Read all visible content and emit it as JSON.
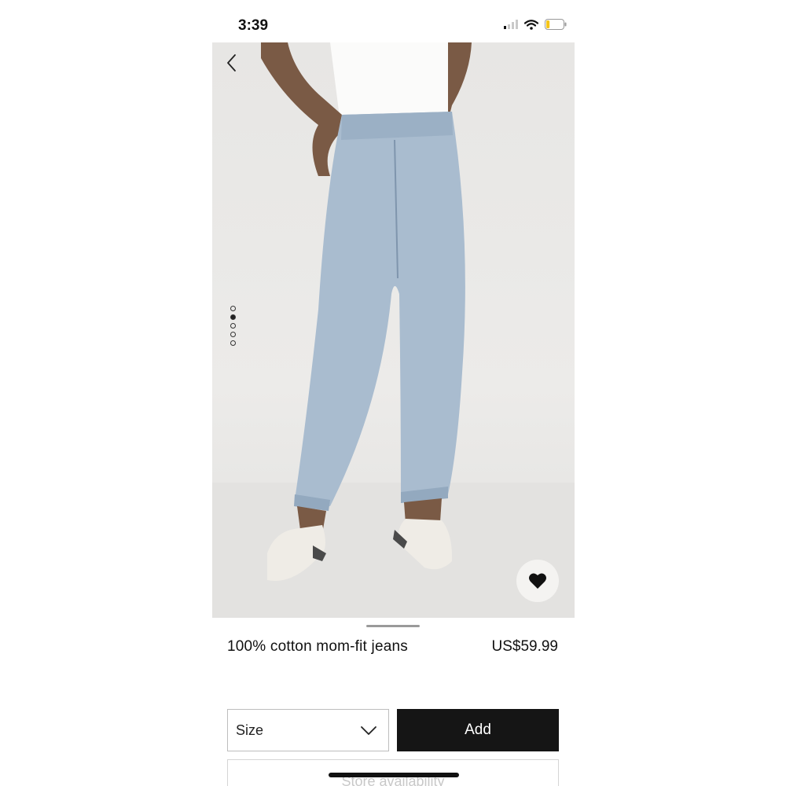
{
  "status_bar": {
    "time": "3:39",
    "signal_bars_on": 1,
    "battery_level": 0.2,
    "battery_color": "#f5c518"
  },
  "gallery": {
    "image_count": 5,
    "active_index": 1,
    "background": "#e9e8e6"
  },
  "product": {
    "name": "100% cotton mom-fit jeans",
    "price": "US$59.99"
  },
  "actions": {
    "size_label": "Size",
    "add_label": "Add",
    "store_label": "Store availability"
  },
  "icons": {
    "back": "chevron-left-icon",
    "favorite": "heart-icon",
    "dropdown": "chevron-down-icon"
  }
}
